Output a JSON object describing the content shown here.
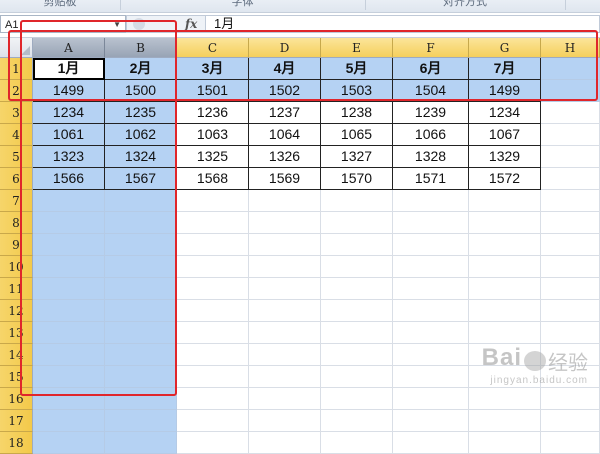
{
  "ribbon": {
    "groups": [
      "剪贴板",
      "字体",
      "对齐方式"
    ]
  },
  "formula_bar": {
    "name_box": "A1",
    "fx_label": "fx",
    "formula_value": "1月"
  },
  "columns": [
    "A",
    "B",
    "C",
    "D",
    "E",
    "F",
    "G",
    "H"
  ],
  "selected_columns": [
    "A",
    "B"
  ],
  "row_numbers": [
    1,
    2,
    3,
    4,
    5,
    6,
    7,
    8,
    9,
    10,
    11,
    12,
    13,
    14,
    15,
    16,
    17,
    18
  ],
  "table": {
    "header": [
      "1月",
      "2月",
      "3月",
      "4月",
      "5月",
      "6月",
      "7月"
    ],
    "rows": [
      [
        "1499",
        "1500",
        "1501",
        "1502",
        "1503",
        "1504",
        "1499"
      ],
      [
        "1234",
        "1235",
        "1236",
        "1237",
        "1238",
        "1239",
        "1234"
      ],
      [
        "1061",
        "1062",
        "1063",
        "1064",
        "1065",
        "1066",
        "1067"
      ],
      [
        "1323",
        "1324",
        "1325",
        "1326",
        "1327",
        "1328",
        "1329"
      ],
      [
        "1566",
        "1567",
        "1568",
        "1569",
        "1570",
        "1571",
        "1572"
      ]
    ]
  },
  "highlighted_rows": [
    1,
    2
  ],
  "colors": {
    "selection": "#b5d2f3",
    "annotation": "#e0262b",
    "header_gold": "#f5cf5c"
  },
  "watermark": {
    "brand": "Bai",
    "brand_cn": "经验",
    "url": "jingyan.baidu.com"
  }
}
